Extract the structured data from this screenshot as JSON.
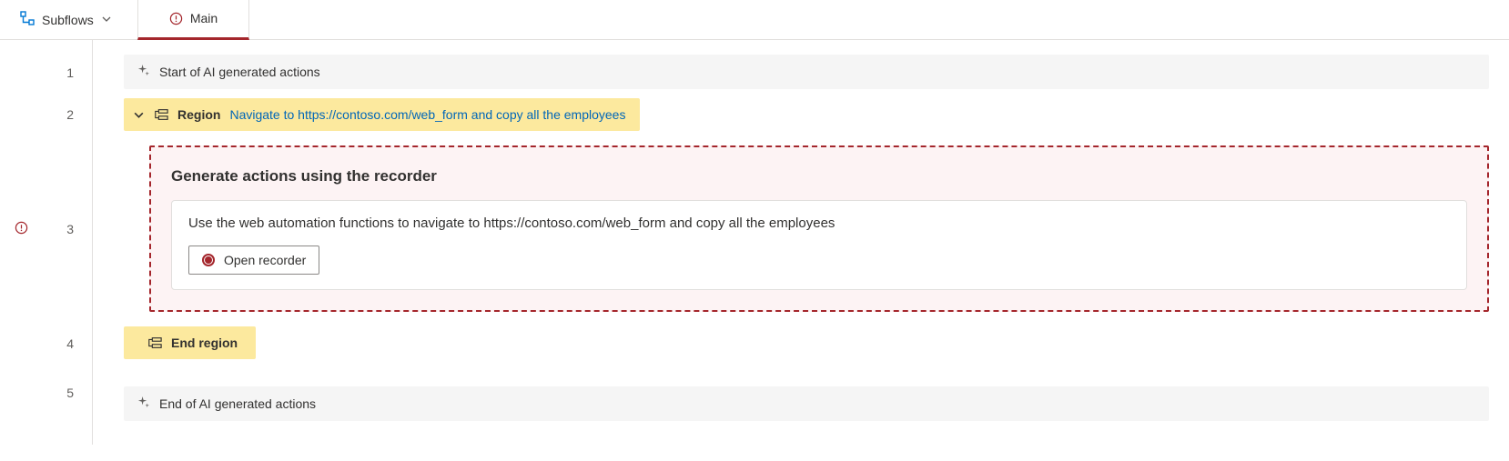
{
  "tabs": {
    "subflows_label": "Subflows",
    "main_label": "Main"
  },
  "lines": {
    "l1": "1",
    "l2": "2",
    "l3": "3",
    "l4": "4",
    "l5": "5"
  },
  "actions": {
    "start_comment": "Start of AI generated actions",
    "region_label": "Region",
    "region_desc": "Navigate to https://contoso.com/web_form and copy all the employees",
    "end_region_label": "End region",
    "end_comment": "End of AI generated actions"
  },
  "recorder": {
    "title": "Generate actions using the recorder",
    "description": "Use the web automation functions to navigate to https://contoso.com/web_form and copy all the employees",
    "button_label": "Open recorder"
  }
}
